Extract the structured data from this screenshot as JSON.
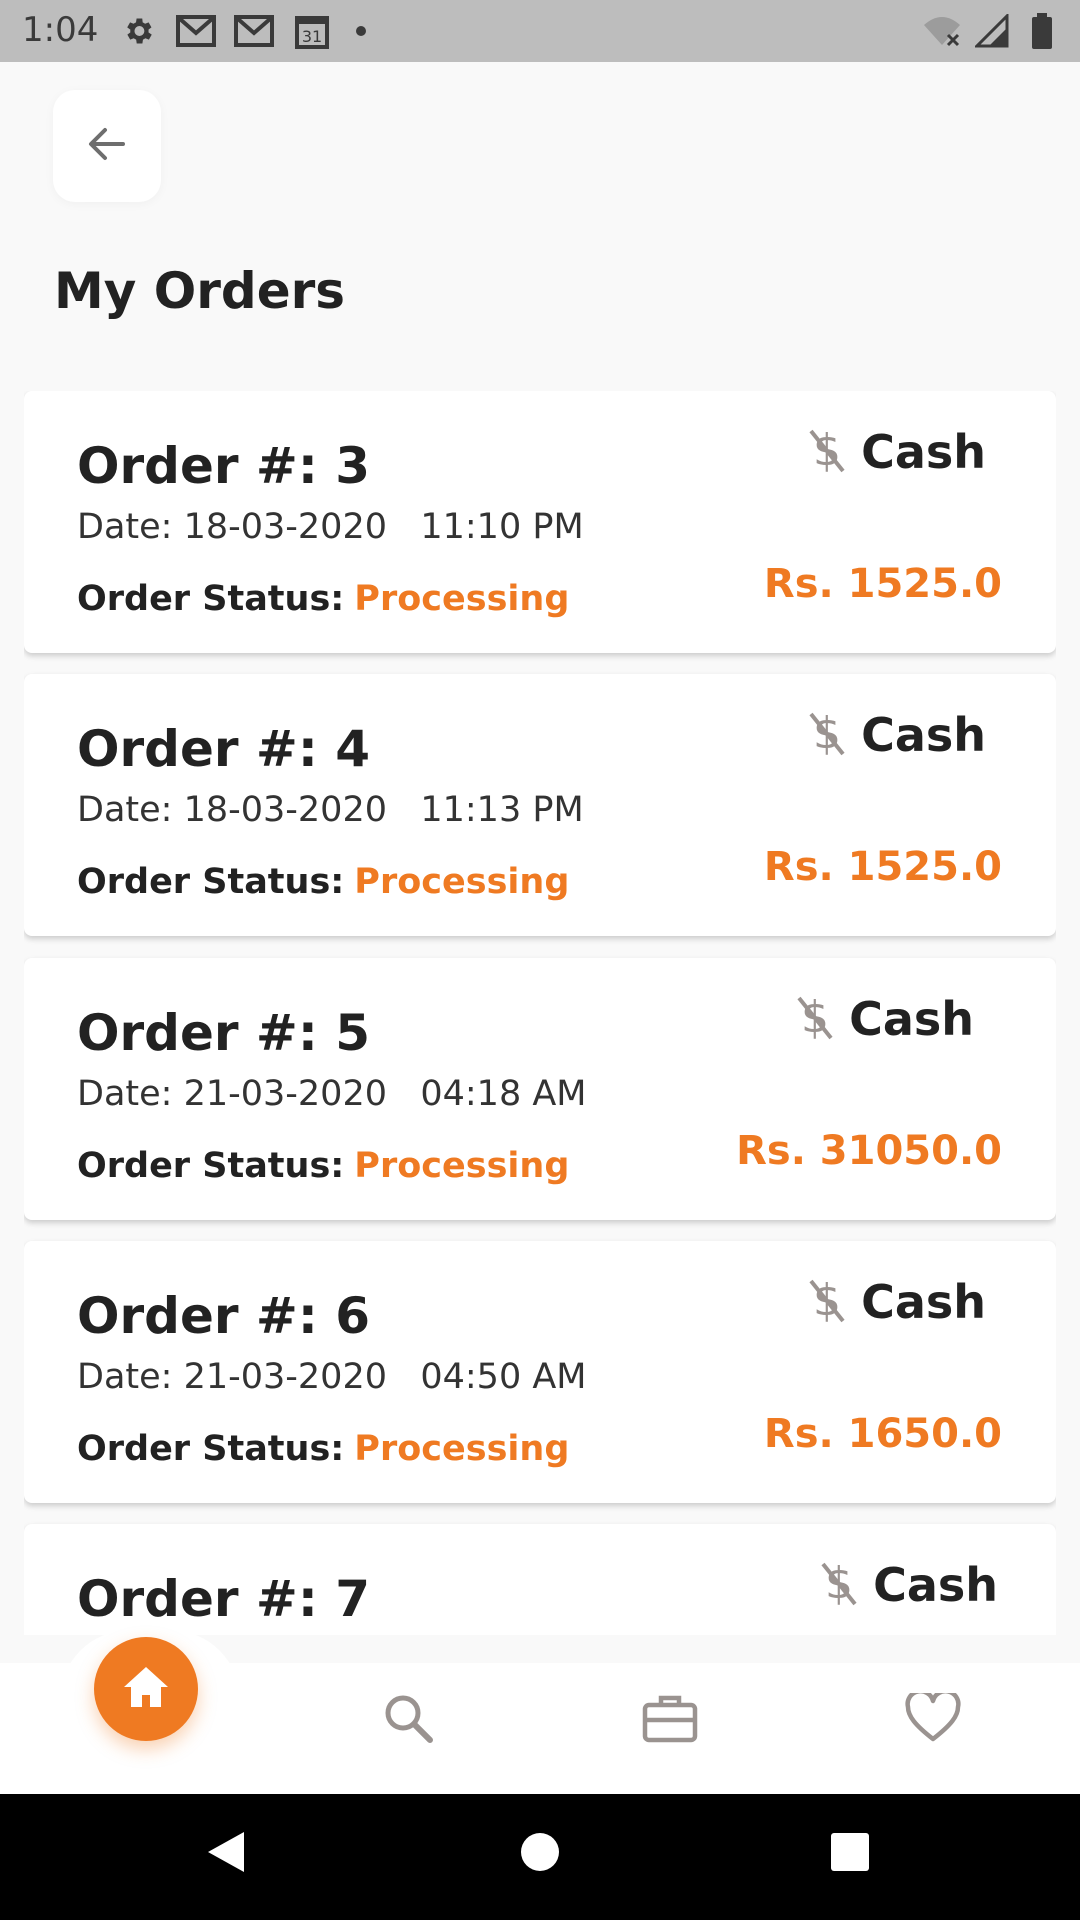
{
  "status_bar": {
    "time": "1:04",
    "left_icons": [
      "gear-icon",
      "gmail-icon",
      "gmail-icon",
      "calendar-icon",
      "dot-icon"
    ],
    "calendar_day": "31",
    "right_icons": [
      "wifi-off-icon",
      "signal-icon",
      "battery-icon"
    ]
  },
  "header": {
    "back_icon": "arrow-left-icon",
    "title": "My Orders"
  },
  "labels": {
    "status_label": "Order Status:"
  },
  "orders": [
    {
      "number": "Order #: 3",
      "date": "Date: 18-03-2020   11:10 PM",
      "status": "Processing",
      "payment": "Cash",
      "amount": "Rs. 1525.0"
    },
    {
      "number": "Order #: 4",
      "date": "Date: 18-03-2020   11:13 PM",
      "status": "Processing",
      "payment": "Cash",
      "amount": "Rs. 1525.0"
    },
    {
      "number": "Order #: 5",
      "date": "Date: 21-03-2020   04:18 AM",
      "status": "Processing",
      "payment": "Cash",
      "amount": "Rs. 31050.0"
    },
    {
      "number": "Order #: 6",
      "date": "Date: 21-03-2020   04:50 AM",
      "status": "Processing",
      "payment": "Cash",
      "amount": "Rs. 1650.0"
    },
    {
      "number": "Order #: 7",
      "date": "",
      "status": "",
      "payment": "Cash",
      "amount": ""
    }
  ],
  "bottom_nav": {
    "items": [
      "home-icon",
      "search-icon",
      "briefcase-icon",
      "heart-icon"
    ],
    "active": "home-icon"
  },
  "colors": {
    "accent": "#ef7a22",
    "status_bar": "#bdbdbd",
    "icon_gray": "#9a9390"
  }
}
